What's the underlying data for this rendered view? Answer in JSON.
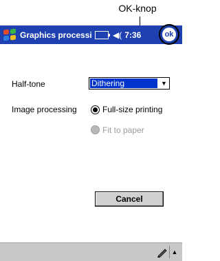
{
  "callout": {
    "label": "OK-knop"
  },
  "titlebar": {
    "title": "Graphics processing",
    "time": "7:36",
    "ok_label": "ok",
    "volume_glyph": "◀("
  },
  "form": {
    "halftone_label": "Half-tone",
    "halftone_value": "Dithering",
    "image_processing_label": "Image processing",
    "options": [
      {
        "label": "Full-size printing",
        "selected": true,
        "enabled": true
      },
      {
        "label": "Fit to paper",
        "selected": false,
        "enabled": false
      }
    ],
    "cancel_label": "Cancel"
  },
  "icons": {
    "start": "windows-flag-icon",
    "battery": "battery-icon",
    "volume": "speaker-icon",
    "pen": "pen-icon",
    "sip": "chevron-up-icon"
  },
  "colors": {
    "titlebar": "#1e40b0",
    "selection": "#0033cc",
    "disabled": "#9a9a9a"
  }
}
